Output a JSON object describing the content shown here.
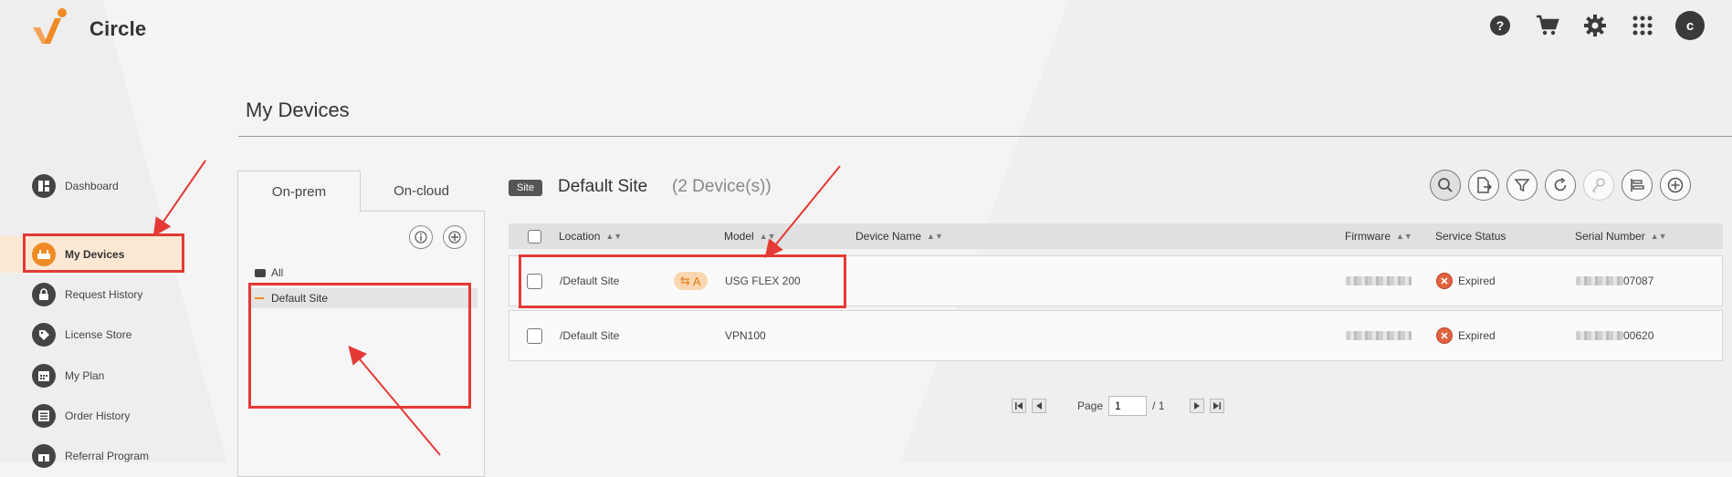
{
  "app": {
    "name": "Circle"
  },
  "colors": {
    "accent": "#f08a24",
    "highlight": "#e53935",
    "expired": "#e0633f"
  },
  "header_icons": [
    "help-icon",
    "cart-icon",
    "gear-icon",
    "apps-grid-icon"
  ],
  "user": {
    "initial": "c"
  },
  "page": {
    "title": "My Devices"
  },
  "sidebar": {
    "items": [
      {
        "label": "Dashboard",
        "icon": "dashboard-icon",
        "active": false
      },
      {
        "label": "My Devices",
        "icon": "devices-icon",
        "active": true
      },
      {
        "label": "Request History",
        "icon": "lock-icon",
        "active": false
      },
      {
        "label": "License Store",
        "icon": "tag-icon",
        "active": false
      },
      {
        "label": "My Plan",
        "icon": "calendar-icon",
        "active": false
      },
      {
        "label": "Order History",
        "icon": "list-icon",
        "active": false
      },
      {
        "label": "Referral Program",
        "icon": "gift-icon",
        "active": false
      }
    ]
  },
  "tree": {
    "tabs": [
      "On-prem",
      "On-cloud"
    ],
    "active_tab": "On-prem",
    "all_label": "All",
    "selected_site": "Default Site"
  },
  "devices": {
    "site_badge": "Site",
    "site_name": "Default Site",
    "count_text": "(2 Device(s))",
    "toolbar": [
      "search-icon",
      "export-icon",
      "filter-icon",
      "refresh-icon",
      "key-icon",
      "align-icon",
      "add-icon"
    ],
    "columns": {
      "location": "Location",
      "model": "Model",
      "device_name": "Device Name",
      "firmware": "Firmware",
      "service_status": "Service Status",
      "serial_number": "Serial Number"
    },
    "rows": [
      {
        "location": "/Default Site",
        "tag": "A",
        "model": "USG FLEX 200",
        "device_name": "",
        "status": "Expired",
        "serial_suffix": "07087"
      },
      {
        "location": "/Default Site",
        "tag": "",
        "model": "VPN100",
        "device_name": "",
        "status": "Expired",
        "serial_suffix": "00620"
      }
    ]
  },
  "pagination": {
    "label": "Page",
    "current": "1",
    "total": "/ 1"
  }
}
